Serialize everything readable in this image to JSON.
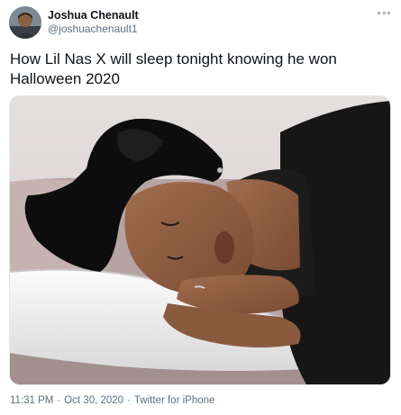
{
  "author": {
    "display_name": "Joshua Chenault",
    "handle": "@joshuachenault1"
  },
  "tweet": {
    "text": "How Lil Nas X will sleep tonight knowing he won Halloween 2020",
    "media_description": "",
    "timestamp_time": "11:31 PM",
    "separator": "·",
    "timestamp_date": "Oct 30, 2020",
    "source": "Twitter for iPhone"
  },
  "icons": {
    "more": "more-options-icon",
    "avatar": "user-avatar"
  },
  "colors": {
    "text_primary": "#0f1419",
    "text_secondary": "#5b7083",
    "border": "#e1e8ed"
  }
}
